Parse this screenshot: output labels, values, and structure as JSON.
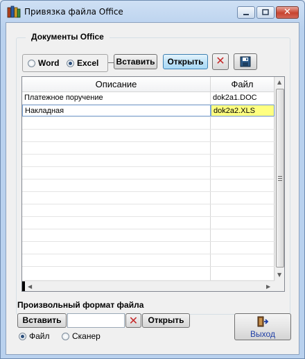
{
  "window": {
    "title": "Привязка файла Office",
    "close_glyph": "✕"
  },
  "documents": {
    "group_title": "Документы Office",
    "format_options": [
      {
        "label": "Word",
        "selected": false
      },
      {
        "label": "Excel",
        "selected": true
      }
    ],
    "insert_label": "Вставить",
    "open_label": "Открыть",
    "delete_glyph": "✕",
    "table": {
      "columns": [
        "Описание",
        "Файл"
      ],
      "rows": [
        {
          "description": "Платежное поручение",
          "file": "dok2a1.DOC",
          "selected": false
        },
        {
          "description": "Накладная",
          "file": "dok2a2.XLS",
          "selected": true
        }
      ]
    }
  },
  "custom_format": {
    "title": "Произвольный формат файла",
    "insert_label": "Вставить",
    "input_value": "",
    "delete_glyph": "✕",
    "open_label": "Открыть",
    "source_options": [
      {
        "label": "Файл",
        "selected": true
      },
      {
        "label": "Сканер",
        "selected": false
      }
    ]
  },
  "exit_label": "Выход",
  "colors": {
    "selected_cell": "#ffff80",
    "accent_delete": "#c62828",
    "exit_text": "#1f3fa6"
  }
}
